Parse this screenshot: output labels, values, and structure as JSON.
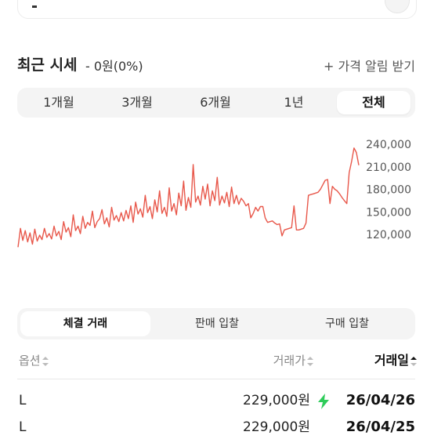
{
  "header": {
    "title": "최근 시세",
    "change": "- 0원(0%)",
    "alert_link": "+ 가격 알림 받기"
  },
  "period_tabs": [
    {
      "label": "1개월",
      "active": false
    },
    {
      "label": "3개월",
      "active": false
    },
    {
      "label": "6개월",
      "active": false
    },
    {
      "label": "1년",
      "active": false
    },
    {
      "label": "전체",
      "active": true
    }
  ],
  "chart_data": {
    "type": "line",
    "title": "",
    "xlabel": "",
    "ylabel": "",
    "ylim": [
      95000,
      250000
    ],
    "y_ticks": [
      240000,
      210000,
      180000,
      150000,
      120000
    ],
    "y_tick_labels": [
      "240,000",
      "210,000",
      "180,000",
      "150,000",
      "120,000"
    ],
    "color": "#e8574a",
    "series": [
      {
        "values": [
          103000,
          128000,
          112000,
          125000,
          110000,
          122000,
          107000,
          127000,
          111000,
          119000,
          113000,
          128000,
          116000,
          121000,
          114000,
          131000,
          118000,
          124000,
          113000,
          137000,
          123000,
          129000,
          117000,
          146000,
          125000,
          131000,
          121000,
          144000,
          128000,
          136000,
          132000,
          151000,
          129000,
          137000,
          141000,
          153000,
          134000,
          142000,
          130000,
          156000,
          139000,
          145000,
          137000,
          149000,
          138000,
          152000,
          141000,
          158000,
          136000,
          163000,
          147000,
          154000,
          143000,
          172000,
          149000,
          157000,
          141000,
          166000,
          150000,
          178000,
          148000,
          156000,
          144000,
          182000,
          151000,
          161000,
          146000,
          175000,
          158000,
          191000,
          152000,
          169000,
          156000,
          213000,
          163000,
          171000,
          159000,
          184000,
          167000,
          187000,
          158000,
          178000,
          165000,
          196000,
          159000,
          171000,
          162000,
          176000,
          157000,
          183000,
          161000,
          172000,
          160000,
          168000,
          164000,
          158000,
          161000,
          142000,
          148000,
          156000,
          151000,
          157000,
          157000,
          142000,
          136000,
          137000,
          138000,
          135000,
          133000,
          134000,
          118000,
          126000,
          127000,
          128000,
          129000,
          158000,
          126000,
          126000,
          127000,
          128000,
          135000,
          172000,
          173000,
          174000,
          175000,
          176000,
          180000,
          186000,
          192000,
          193000,
          161000,
          184000,
          180000,
          178000,
          174000,
          169000,
          165000,
          161000,
          202000,
          217000,
          235000,
          229000,
          212000
        ]
      }
    ]
  },
  "trade_tabs": [
    {
      "label": "체결 거래",
      "active": true
    },
    {
      "label": "판매 입찰",
      "active": false
    },
    {
      "label": "구매 입찰",
      "active": false
    }
  ],
  "table": {
    "columns": {
      "option": "옵션",
      "price": "거래가",
      "date": "거래일"
    },
    "rows": [
      {
        "size": "L",
        "price": "229,000원",
        "fast": true,
        "date": "26/04/26"
      },
      {
        "size": "L",
        "price": "229,000원",
        "fast": false,
        "date": "26/04/25"
      }
    ]
  },
  "colors": {
    "chart_line": "#e8574a",
    "bolt": "#2ecc5a",
    "tab_bg": "#f4f4f4"
  },
  "icons": {
    "sort": "sort-icon",
    "fast_delivery": "lightning-bolt-icon"
  }
}
